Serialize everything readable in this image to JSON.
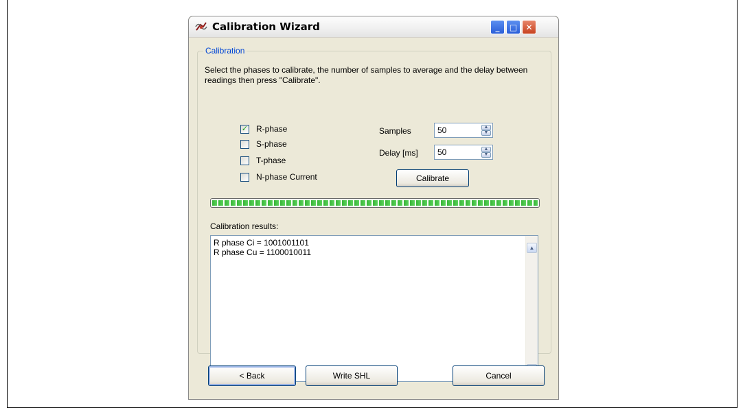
{
  "window": {
    "title": "Calibration Wizard",
    "icon": "calibration-wizard-app-icon",
    "controls": {
      "minimize": "_",
      "maximize": "□",
      "close": "✕"
    }
  },
  "group": {
    "title": "Calibration",
    "instructions": "Select the phases to calibrate, the number of samples to average and the delay between readings then press \"Calibrate\"."
  },
  "phases": [
    {
      "label": "R-phase",
      "checked": true
    },
    {
      "label": "S-phase",
      "checked": false
    },
    {
      "label": "T-phase",
      "checked": false
    },
    {
      "label": "N-phase Current",
      "checked": false
    }
  ],
  "settings": {
    "samples_label": "Samples",
    "samples_value": "50",
    "delay_label": "Delay [ms]",
    "delay_value": "50"
  },
  "calibrate_label": "Calibrate",
  "progress": {
    "value_percent": 100
  },
  "results": {
    "label": "Calibration results:",
    "lines": [
      "R phase Ci = 1001001101",
      "R phase Cu = 1100010011"
    ]
  },
  "footer": {
    "back_label": "< Back",
    "write_label": "Write SHL",
    "cancel_label": "Cancel"
  },
  "colors": {
    "window_bg": "#ece9d8",
    "group_title": "#0046d5",
    "progress_fill": "#37b337",
    "check_mark": "#21a121"
  }
}
